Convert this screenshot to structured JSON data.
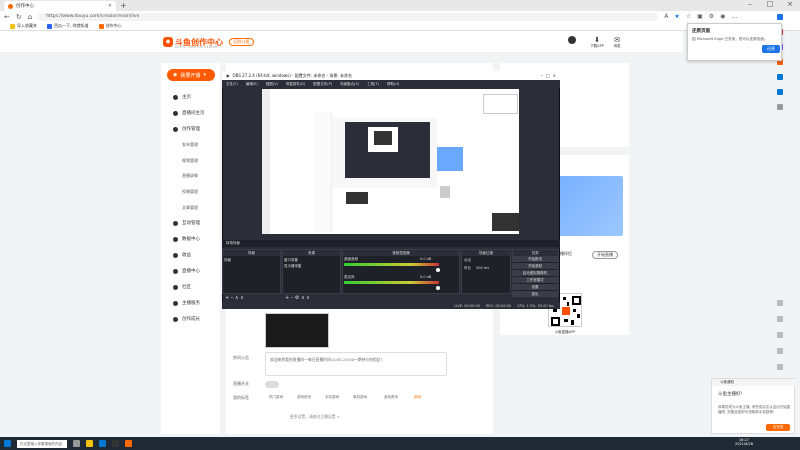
{
  "browser": {
    "tab_title": "创作中心",
    "url": "https://www.douyu.com/creator/main/live",
    "bookmarks": [
      "导入收藏夹",
      "西瓜一下, 你就知道",
      "创作中心"
    ]
  },
  "site": {
    "logo_text": "斗鱼创作中心",
    "logo_sub": "DOUYU CREATOR CENTER",
    "header_btn": "回到斗鱼",
    "header_icons": [
      {
        "glyph": "⬇",
        "label": "下载APP"
      },
      {
        "glyph": "✉",
        "label": "消息"
      }
    ]
  },
  "sidebar": {
    "live_button": "我要开播",
    "items": [
      {
        "label": "主页",
        "icon": "home-icon"
      },
      {
        "label": "直播间主页",
        "icon": "room-icon"
      },
      {
        "label": "创作管理",
        "icon": "shield-icon"
      }
    ],
    "sub_items": [
      "发布管理",
      "视频管理",
      "直播录像",
      "投稿管理",
      "文章管理"
    ],
    "items2": [
      {
        "label": "互动管理"
      },
      {
        "label": "数据中心"
      },
      {
        "label": "收益"
      },
      {
        "label": "直播中心"
      },
      {
        "label": "社区"
      },
      {
        "label": "主播服务"
      },
      {
        "label": "创作成长"
      }
    ]
  },
  "obs": {
    "title": "OBS 27.2.4 (64-bit, windows) - 配置文件: 未命名 - 场景: 未命名",
    "menu": [
      "文件(F)",
      "编辑(E)",
      "视图(V)",
      "停靠部件(D)",
      "配置文件(P)",
      "场景集合(S)",
      "工具(T)",
      "帮助(H)"
    ],
    "scene_header": "转场场景",
    "panels": [
      "场景",
      "来源",
      "音频混音器",
      "场景过渡",
      "控件"
    ],
    "scene_item": "场景",
    "sources": [
      "窗口采集",
      "显示器采集"
    ],
    "mixer": [
      {
        "label": "桌面音频",
        "level": "0.0 dB"
      },
      {
        "label": "麦克风",
        "level": "0.0 dB"
      }
    ],
    "transition": [
      "淡出",
      "时长",
      "300 ms"
    ],
    "controls": [
      "开始推流",
      "开始录制",
      "启动虚拟摄像机",
      "工作室模式",
      "设置",
      "退出"
    ],
    "status": [
      "LIVE: 00:00:00",
      "REC: 00:00:00",
      "CPU: 1.3%, 30.00 fps"
    ]
  },
  "main": {
    "notice_label": "房间公告",
    "notice_text": "欢迎来到我的直播间～每日直播时间14:00-24:00～期待与你相见！",
    "toggle_label": "直播开关",
    "tags_label": "我的标签",
    "tags": [
      "热门游戏",
      "游戏资讯",
      "手机游戏",
      "单机游戏",
      "游戏资讯",
      "游戏"
    ],
    "bottom_text": "更多设置，请前往主播设置 >"
  },
  "right": {
    "promo_text": "斗鱼创作者 全新上线",
    "download_text": "下载斗鱼直播伴侣",
    "download_btn": "开始直播",
    "qr_label": "斗鱼直播APP"
  },
  "popup": {
    "title": "还原页面",
    "body": "因 Microsoft Edge 已关闭，您可以还原页面。",
    "button": "还原"
  },
  "notify": {
    "header": "斗鱼通知",
    "title": "斗鱼主播好!",
    "body": "恭喜您成为斗鱼主播, 请完成实名认证后开始直播吧, 完善信息即可领取新手奖励哦!",
    "button": "去完成"
  },
  "taskbar": {
    "search": "在这里输入你要搜索的内容",
    "time": "16:27",
    "date": "2021/6/28"
  }
}
